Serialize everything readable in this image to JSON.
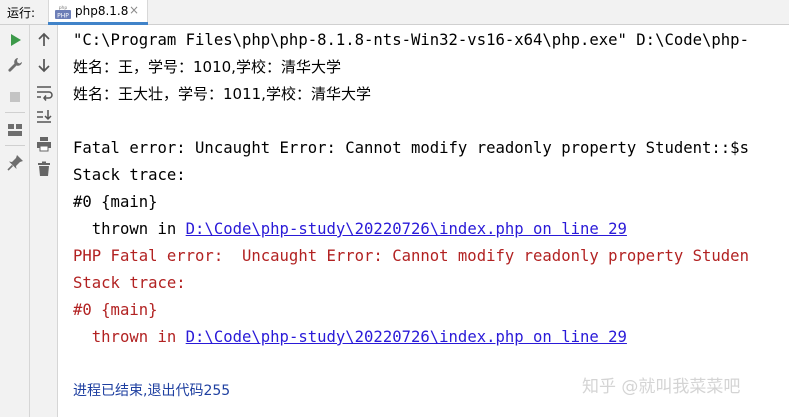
{
  "topbar": {
    "run_label": "运行:",
    "tab": {
      "label": "php8.1.8",
      "close": "×",
      "icon_badge": "PHP",
      "icon_top": "php"
    }
  },
  "toolbar_left": [
    {
      "name": "run-icon"
    },
    {
      "name": "wrench-icon"
    },
    {
      "name": "stop-icon"
    },
    {
      "name": "layout-icon"
    },
    {
      "name": "pin-icon"
    }
  ],
  "toolbar_right": [
    {
      "name": "arrow-up-icon"
    },
    {
      "name": "arrow-down-icon"
    },
    {
      "name": "soft-wrap-icon"
    },
    {
      "name": "scroll-to-end-icon"
    },
    {
      "name": "print-icon"
    },
    {
      "name": "trash-icon"
    }
  ],
  "console": {
    "command": "\"C:\\Program Files\\php\\php-8.1.8-nts-Win32-vs16-x64\\php.exe\" D:\\Code\\php-",
    "out1": "姓名：王，学号：1010,学校：清华大学",
    "out2": "姓名：王大壮，学号：1011,学校：清华大学",
    "fatal1": "Fatal error: Uncaught Error: Cannot modify readonly property Student::$s",
    "stack1": "Stack trace:",
    "main1": "#0 {main}",
    "thrown1_prefix": "  thrown in ",
    "link1": "D:\\Code\\php-study\\20220726\\index.php on line 29",
    "fatal2": "PHP Fatal error:  Uncaught Error: Cannot modify readonly property Studen",
    "stack2": "Stack trace:",
    "main2": "#0 {main}",
    "thrown2_prefix": "  thrown in ",
    "link2": "D:\\Code\\php-study\\20220726\\index.php on line 29",
    "exit": "进程已结束,退出代码255"
  },
  "watermark": "知乎 @就叫我菜菜吧",
  "colors": {
    "error": "#b22222",
    "link": "#2a1ad8",
    "exit": "#1e3fa0",
    "run_green": "#3d9a4a"
  }
}
